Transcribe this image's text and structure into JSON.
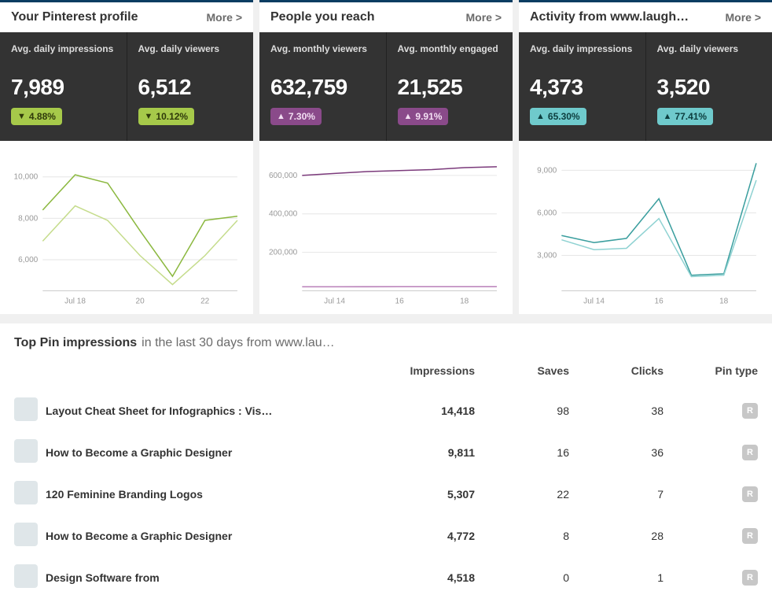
{
  "panels": [
    {
      "title": "Your Pinterest profile",
      "more": "More >",
      "stats": [
        {
          "label": "Avg. daily impressions",
          "value": "7,989",
          "change": "4.88%",
          "dir": "down"
        },
        {
          "label": "Avg. daily viewers",
          "value": "6,512",
          "change": "10.12%",
          "dir": "down"
        }
      ]
    },
    {
      "title": "People you reach",
      "more": "More >",
      "stats": [
        {
          "label": "Avg. monthly viewers",
          "value": "632,759",
          "change": "7.30%",
          "dir": "up"
        },
        {
          "label": "Avg. monthly engaged",
          "value": "21,525",
          "change": "9.91%",
          "dir": "up"
        }
      ]
    },
    {
      "title": "Activity from www.laugh…",
      "more": "More >",
      "stats": [
        {
          "label": "Avg. daily impressions",
          "value": "4,373",
          "change": "65.30%",
          "dir": "up"
        },
        {
          "label": "Avg. daily viewers",
          "value": "3,520",
          "change": "77.41%",
          "dir": "up"
        }
      ]
    }
  ],
  "top_pins": {
    "title": "Top Pin impressions",
    "subtitle": "in the last 30 days from www.lau…",
    "columns": {
      "impressions": "Impressions",
      "saves": "Saves",
      "clicks": "Clicks",
      "pin_type": "Pin type"
    },
    "rows": [
      {
        "title": "Layout Cheat Sheet for Infographics : Vis…",
        "impressions": "14,418",
        "saves": "98",
        "clicks": "38",
        "type": "R"
      },
      {
        "title": "How to Become a Graphic Designer",
        "impressions": "9,811",
        "saves": "16",
        "clicks": "36",
        "type": "R"
      },
      {
        "title": "120 Feminine Branding Logos",
        "impressions": "5,307",
        "saves": "22",
        "clicks": "7",
        "type": "R"
      },
      {
        "title": "How to Become a Graphic Designer",
        "impressions": "4,772",
        "saves": "8",
        "clicks": "28",
        "type": "R"
      },
      {
        "title": "Design Software from",
        "impressions": "4,518",
        "saves": "0",
        "clicks": "1",
        "type": "R"
      }
    ]
  },
  "chart_data": [
    {
      "type": "line",
      "x": [
        "Jul 17",
        "Jul 18",
        "Jul 19",
        "Jul 20",
        "Jul 21",
        "Jul 22",
        "Jul 23"
      ],
      "x_ticks": [
        "Jul 18",
        "20",
        "22"
      ],
      "y_ticks": [
        6000,
        8000,
        10000
      ],
      "y_tick_labels": [
        "6,000",
        "8,000",
        "10,000"
      ],
      "ylim": [
        4500,
        11000
      ],
      "series": [
        {
          "name": "Avg. daily impressions",
          "values": [
            8400,
            10100,
            9700,
            7400,
            5200,
            7900,
            8100
          ]
        },
        {
          "name": "Avg. daily viewers",
          "values": [
            6900,
            8600,
            7900,
            6200,
            4800,
            6200,
            7900
          ]
        }
      ]
    },
    {
      "type": "line",
      "x": [
        "Jul 13",
        "Jul 14",
        "Jul 15",
        "Jul 16",
        "Jul 17",
        "Jul 18",
        "Jul 19"
      ],
      "x_ticks": [
        "Jul 14",
        "16",
        "18"
      ],
      "y_ticks": [
        200000,
        400000,
        600000
      ],
      "y_tick_labels": [
        "200,000",
        "400,000",
        "600,000"
      ],
      "ylim": [
        0,
        700000
      ],
      "series": [
        {
          "name": "Avg. monthly viewers",
          "values": [
            600000,
            610000,
            620000,
            625000,
            630000,
            640000,
            645000
          ]
        },
        {
          "name": "Avg. monthly engaged",
          "values": [
            21000,
            21200,
            21300,
            21400,
            21500,
            21600,
            21700
          ]
        }
      ]
    },
    {
      "type": "line",
      "x": [
        "Jul 13",
        "Jul 14",
        "Jul 15",
        "Jul 16",
        "Jul 17",
        "Jul 18",
        "Jul 19"
      ],
      "x_ticks": [
        "Jul 14",
        "16",
        "18"
      ],
      "y_ticks": [
        3000,
        6000,
        9000
      ],
      "y_tick_labels": [
        "3,000",
        "6,000",
        "9,000"
      ],
      "ylim": [
        500,
        10000
      ],
      "series": [
        {
          "name": "Avg. daily impressions",
          "values": [
            4400,
            3900,
            4200,
            7000,
            1600,
            1700,
            9500
          ]
        },
        {
          "name": "Avg. daily viewers",
          "values": [
            4100,
            3400,
            3500,
            5600,
            1500,
            1600,
            8300
          ]
        }
      ]
    }
  ]
}
